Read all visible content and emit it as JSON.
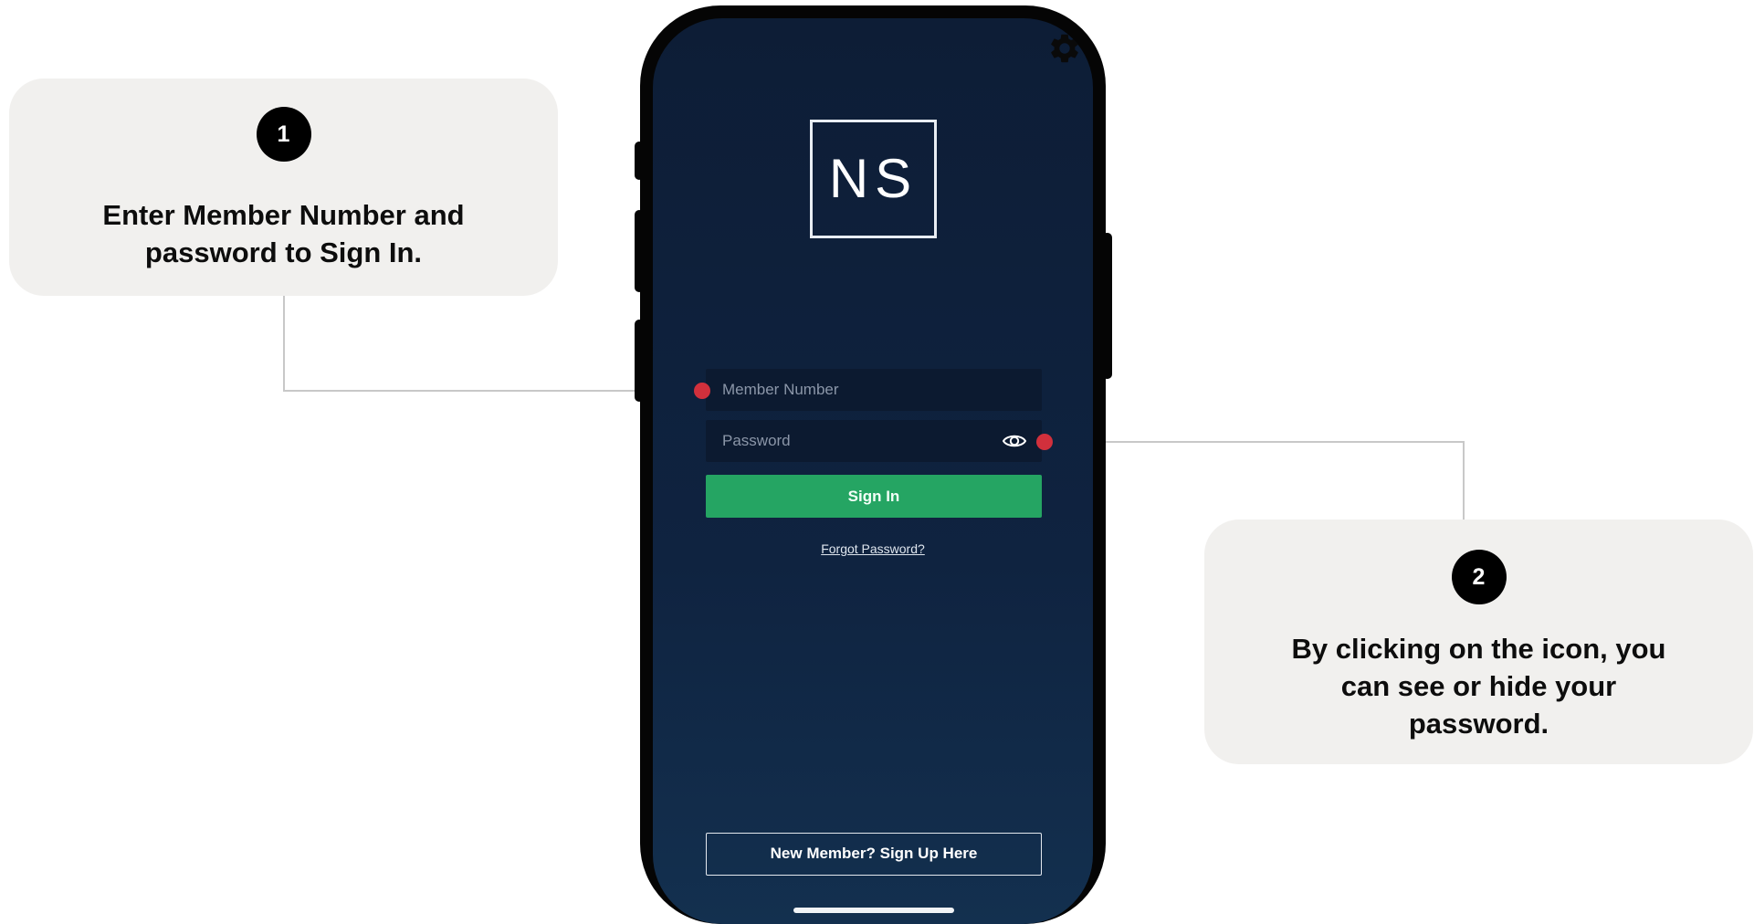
{
  "callouts": [
    {
      "number": "1",
      "text": "Enter Member Number and password to Sign In."
    },
    {
      "number": "2",
      "text": "By clicking on the icon, you can see or  hide your password."
    }
  ],
  "app": {
    "logo_text": "NS",
    "member_placeholder": "Member Number",
    "password_placeholder": "Password",
    "sign_in_label": "Sign In",
    "forgot_password_label": "Forgot Password?",
    "sign_up_label": "New Member? Sign Up Here"
  },
  "icons": {
    "settings": "gear-icon",
    "password_visibility": "eye-icon"
  },
  "colors": {
    "screen_background": "#0d1d36",
    "sign_in_button": "#25a563",
    "callout_background": "#f1f0ee",
    "marker_dot": "#d1303c",
    "connector_line": "#c8c8c8"
  }
}
